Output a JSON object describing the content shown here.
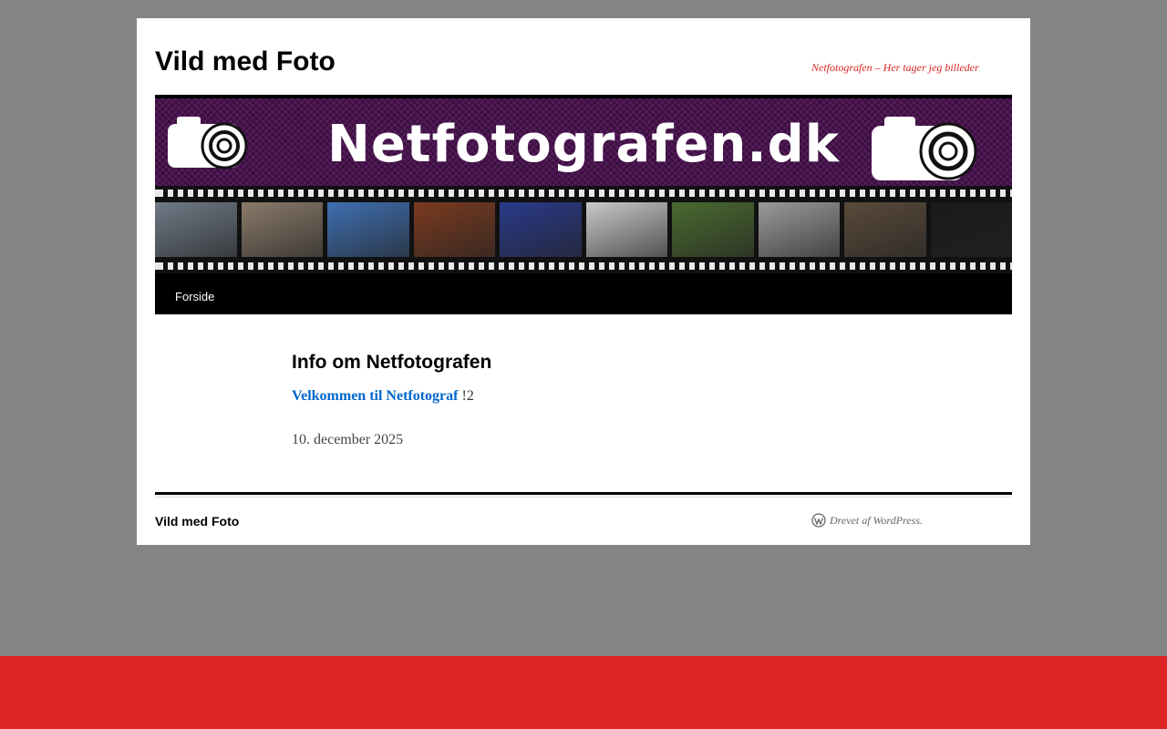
{
  "site": {
    "title": "Vild med Foto",
    "description": "Netfotografen – Her tager jeg billeder"
  },
  "header": {
    "banner_text": "Netfotografen.dk",
    "banner_icons": [
      "camera-icon",
      "camera-icon"
    ],
    "photo_colors": [
      "#6f7a86",
      "#8a7a6a",
      "#3f6fb0",
      "#7a3a20",
      "#2a3a8a",
      "#c9c9c9",
      "#4a6a30",
      "#9a9a9a",
      "#5a4a3a",
      "#1a1a1a"
    ]
  },
  "nav": {
    "items": [
      {
        "label": "Forside"
      }
    ]
  },
  "main": {
    "entry_title": "Info om Netfotografen",
    "welcome_link": "Velkommen til Netfotograf",
    "welcome_suffix": " !2",
    "date": "10. december 2025"
  },
  "footer": {
    "site_title": "Vild med Foto",
    "powered_by": "Drevet af WordPress.",
    "powered_icon": "wordpress-icon"
  },
  "colors": {
    "page_background": "#848484",
    "description": "#dd2222",
    "link": "#0066cc",
    "bottom_band": "#dd2525"
  }
}
